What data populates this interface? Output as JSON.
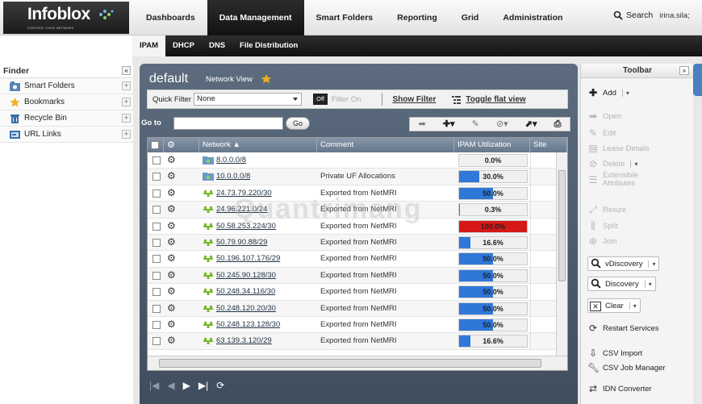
{
  "app": {
    "logo_text": "Infoblox",
    "logo_tagline": "CONTROL YOUR NETWORK"
  },
  "main_nav": [
    "Dashboards",
    "Data Management",
    "Smart Folders",
    "Reporting",
    "Grid",
    "Administration"
  ],
  "main_nav_active": "Data Management",
  "search": {
    "label": "Search",
    "user": "irina.sila;"
  },
  "sub_nav": [
    "IPAM",
    "DHCP",
    "DNS",
    "File Distribution"
  ],
  "sub_nav_active": "IPAM",
  "finder": {
    "title": "Finder",
    "collapse": "«",
    "items": [
      {
        "label": "Smart Folders",
        "icon": "smart-folder-icon"
      },
      {
        "label": "Bookmarks",
        "icon": "star-icon"
      },
      {
        "label": "Recycle Bin",
        "icon": "recycle-bin-icon"
      },
      {
        "label": "URL Links",
        "icon": "url-link-icon"
      }
    ]
  },
  "panel": {
    "title": "default",
    "network_view_label": "Network View",
    "quick_filter_label": "Quick Filter",
    "quick_filter_value": "None",
    "off_label": "Off",
    "filter_on_label": "Filter On",
    "show_filter": "Show Filter",
    "toggle_flat": "Toggle flat view",
    "goto_label": "Go to",
    "go_button": "Go"
  },
  "table": {
    "headers": [
      "Network ▲",
      "Comment",
      "IPAM Utilization",
      "Site"
    ],
    "rows": [
      {
        "network": "8.0.0.0/8",
        "comment": "",
        "util": "0.0%",
        "pct": 0,
        "icon": "folder"
      },
      {
        "network": "10.0.0.0/8",
        "comment": "Private UF Allocations",
        "util": "30.0%",
        "pct": 30,
        "icon": "folder"
      },
      {
        "network": "24.73.79.220/30",
        "comment": "Exported from NetMRI",
        "util": "50.0%",
        "pct": 50,
        "icon": "network"
      },
      {
        "network": "24.96.221.0/24",
        "comment": "Exported from NetMRI",
        "util": "0.3%",
        "pct": 0.3,
        "icon": "network"
      },
      {
        "network": "50.58.253.224/30",
        "comment": "Exported from NetMRI",
        "util": "100.0%",
        "pct": 100,
        "icon": "network"
      },
      {
        "network": "50.79.90.88/29",
        "comment": "Exported from NetMRI",
        "util": "16.6%",
        "pct": 16.6,
        "icon": "network"
      },
      {
        "network": "50.196.107.176/29",
        "comment": "Exported from NetMRI",
        "util": "50.0%",
        "pct": 50,
        "icon": "network"
      },
      {
        "network": "50.245.90.128/30",
        "comment": "Exported from NetMRI",
        "util": "50.0%",
        "pct": 50,
        "icon": "network"
      },
      {
        "network": "50.248.34.116/30",
        "comment": "Exported from NetMRI",
        "util": "50.0%",
        "pct": 50,
        "icon": "network"
      },
      {
        "network": "50.248.120.20/30",
        "comment": "Exported from NetMRI",
        "util": "50.0%",
        "pct": 50,
        "icon": "network"
      },
      {
        "network": "50.248.123.128/30",
        "comment": "Exported from NetMRI",
        "util": "50.0%",
        "pct": 50,
        "icon": "network"
      },
      {
        "network": "63.139.3.120/29",
        "comment": "Exported from NetMRI",
        "util": "16.6%",
        "pct": 16.6,
        "icon": "network"
      }
    ]
  },
  "toolbar": {
    "title": "Toolbar",
    "collapse": "»",
    "items": [
      {
        "label": "Add",
        "icon": "add-icon",
        "enabled": true,
        "dropdown": true
      },
      {
        "label": "Open",
        "icon": "open-icon",
        "enabled": false
      },
      {
        "label": "Edit",
        "icon": "edit-icon",
        "enabled": false
      },
      {
        "label": "Lease Details",
        "icon": "lease-icon",
        "enabled": false
      },
      {
        "label": "Delete",
        "icon": "delete-icon",
        "enabled": false,
        "dropdown": true
      },
      {
        "label": "Extensible Attributes",
        "icon": "attributes-icon",
        "enabled": false
      },
      {
        "label": "Resize",
        "icon": "resize-icon",
        "enabled": false
      },
      {
        "label": "Split",
        "icon": "split-icon",
        "enabled": false
      },
      {
        "label": "Join",
        "icon": "join-icon",
        "enabled": false
      },
      {
        "label": "vDiscovery",
        "icon": "search-icon",
        "enabled": true,
        "dropdown": true
      },
      {
        "label": "Discovery",
        "icon": "search-icon",
        "enabled": true,
        "dropdown": true
      },
      {
        "label": "Clear",
        "icon": "clear-icon",
        "enabled": true,
        "dropdown": true
      },
      {
        "label": "Restart Services",
        "icon": "restart-icon",
        "enabled": true
      },
      {
        "label": "CSV Import",
        "icon": "csv-import-icon",
        "enabled": true
      },
      {
        "label": "CSV Job Manager",
        "icon": "wrench-icon",
        "enabled": true
      },
      {
        "label": "IDN Converter",
        "icon": "converter-icon",
        "enabled": true
      }
    ]
  },
  "colors": {
    "accent_blue": "#2f78d8",
    "alert_red": "#d61818",
    "panel_bg": "#4f5f72"
  },
  "watermark": "Quantrimang"
}
